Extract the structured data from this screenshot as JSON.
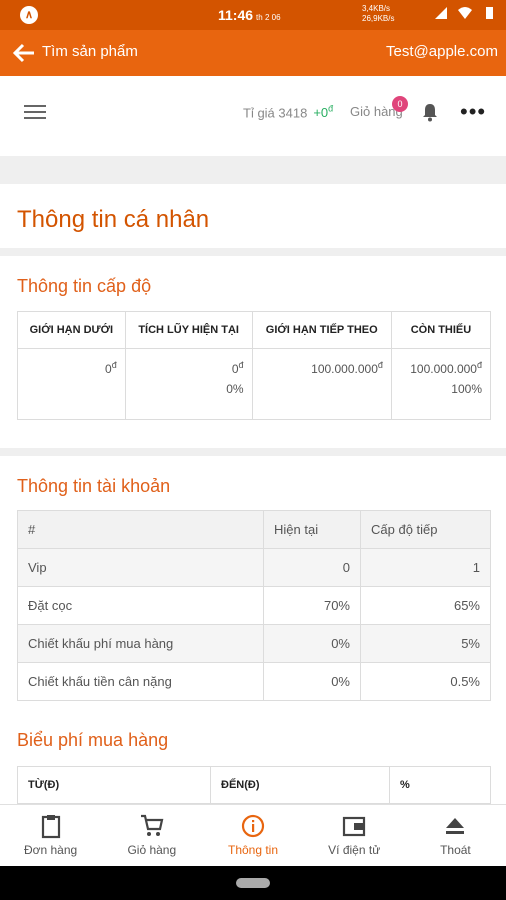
{
  "status": {
    "time": "11:46",
    "date": "th 2 06",
    "net_up": "3,4KB/s",
    "net_down": "26,9KB/s"
  },
  "appbar": {
    "title": "Tìm sản phẩm",
    "email": "Test@apple.com"
  },
  "toolbar": {
    "rate_label": "Tỉ giá 3418",
    "rate_change": "+0",
    "currency": "đ",
    "cart_label": "Giỏ hàng",
    "cart_count": "0"
  },
  "page": {
    "title": "Thông tin cá nhân"
  },
  "level": {
    "title": "Thông tin cấp độ",
    "headers": [
      "GIỚI HẠN DƯỚI",
      "TÍCH LŨY HIỆN TẠI",
      "GIỚI HẠN TIẾP THEO",
      "CÒN THIẾU"
    ],
    "cells": [
      {
        "value": "0",
        "pct": ""
      },
      {
        "value": "0",
        "pct": "0%"
      },
      {
        "value": "100.000.000",
        "pct": ""
      },
      {
        "value": "100.000.000",
        "pct": "100%"
      }
    ]
  },
  "account": {
    "title": "Thông tin tài khoản",
    "headers": [
      "#",
      "Hiện tại",
      "Cấp độ tiếp"
    ],
    "rows": [
      [
        "Vip",
        "0",
        "1"
      ],
      [
        "Đặt cọc",
        "70%",
        "65%"
      ],
      [
        "Chiết khấu phí mua hàng",
        "0%",
        "5%"
      ],
      [
        "Chiết khấu tiền cân nặng",
        "0%",
        "0.5%"
      ]
    ]
  },
  "fee": {
    "title": "Biểu phí mua hàng",
    "headers": [
      "TỪ(Đ)",
      "ĐẾN(Đ)",
      "%"
    ]
  },
  "nav": [
    {
      "label": "Đơn hàng",
      "icon": "clipboard-icon"
    },
    {
      "label": "Giỏ hàng",
      "icon": "cart-icon"
    },
    {
      "label": "Thông tin",
      "icon": "info-icon"
    },
    {
      "label": "Ví điện tử",
      "icon": "wallet-icon"
    },
    {
      "label": "Thoát",
      "icon": "eject-icon"
    }
  ],
  "colors": {
    "primary": "#e8650f",
    "status": "#d35400",
    "title": "#e0601a"
  }
}
